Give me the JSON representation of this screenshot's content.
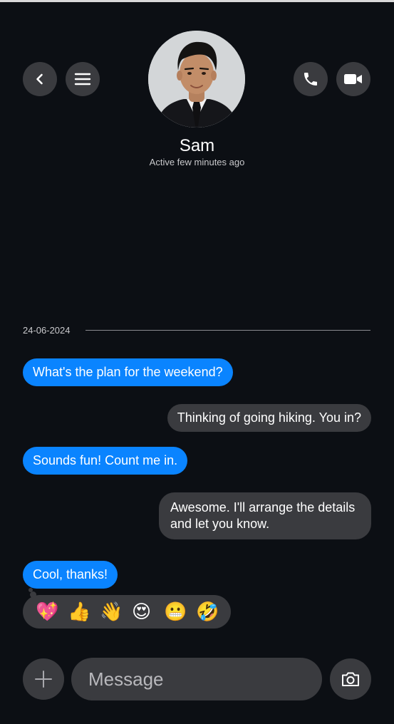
{
  "contact": {
    "name": "Sam",
    "status": "Active few minutes ago"
  },
  "header": {
    "back_icon": "chevron-left-icon",
    "menu_icon": "hamburger-menu-icon",
    "call_icon": "phone-icon",
    "video_icon": "video-camera-icon"
  },
  "date_separator": "24-06-2024",
  "messages": [
    {
      "direction": "incoming",
      "text": "What's the plan for the weekend?"
    },
    {
      "direction": "outgoing",
      "text": "Thinking of going hiking. You in?"
    },
    {
      "direction": "incoming",
      "text": "Sounds fun! Count me in."
    },
    {
      "direction": "outgoing",
      "text": "Awesome. I'll arrange the details and let you know."
    },
    {
      "direction": "incoming",
      "text": "Cool, thanks!"
    }
  ],
  "reactions": [
    {
      "name": "sparkling-heart",
      "glyph": "💖"
    },
    {
      "name": "thumbs-up",
      "glyph": "👍"
    },
    {
      "name": "waving-hand",
      "glyph": "👋"
    },
    {
      "name": "heart-eyes",
      "glyph": "😍"
    },
    {
      "name": "grimacing-face",
      "glyph": "😬"
    },
    {
      "name": "rolling-laughing",
      "glyph": "🤣"
    }
  ],
  "composer": {
    "placeholder": "Message",
    "add_icon": "plus-icon",
    "camera_icon": "camera-icon"
  },
  "colors": {
    "background": "#0c0f14",
    "incoming_bubble": "#0a84ff",
    "outgoing_bubble": "#3a3b3f"
  }
}
